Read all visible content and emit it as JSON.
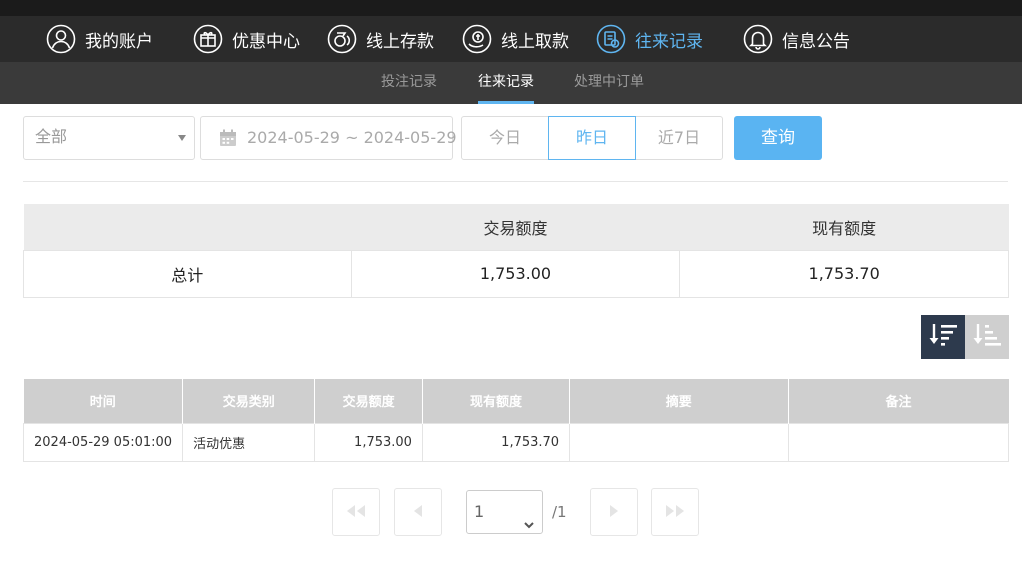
{
  "nav": {
    "items": [
      {
        "label": "我的账户",
        "icon": "user-icon"
      },
      {
        "label": "优惠中心",
        "icon": "gift-icon"
      },
      {
        "label": "线上存款",
        "icon": "deposit-icon"
      },
      {
        "label": "线上取款",
        "icon": "withdraw-icon"
      },
      {
        "label": "往来记录",
        "icon": "records-icon"
      },
      {
        "label": "信息公告",
        "icon": "bell-icon"
      }
    ],
    "active_color": "#5fb5f0"
  },
  "subnav": {
    "items": [
      {
        "label": "投注记录"
      },
      {
        "label": "往来记录"
      },
      {
        "label": "处理中订单"
      }
    ]
  },
  "filter": {
    "type_value": "全部",
    "date_range": "2024-05-29 ~ 2024-05-29",
    "quick": [
      {
        "label": "今日"
      },
      {
        "label": "昨日"
      },
      {
        "label": "近7日"
      }
    ],
    "query_label": "查询",
    "accent": "#5ab4f2"
  },
  "summary": {
    "headers": [
      "",
      "交易额度",
      "现有额度"
    ],
    "row": {
      "label": "总计",
      "amount": "1,753.00",
      "balance": "1,753.70"
    }
  },
  "detail": {
    "headers": [
      "时间",
      "交易类别",
      "交易额度",
      "现有额度",
      "摘要",
      "备注"
    ],
    "rows": [
      {
        "time": "2024-05-29 05:01:00",
        "type": "活动优惠",
        "amount": "1,753.00",
        "balance": "1,753.70",
        "summary": "",
        "remark": ""
      }
    ]
  },
  "pager": {
    "current": "1",
    "total": "/1"
  }
}
